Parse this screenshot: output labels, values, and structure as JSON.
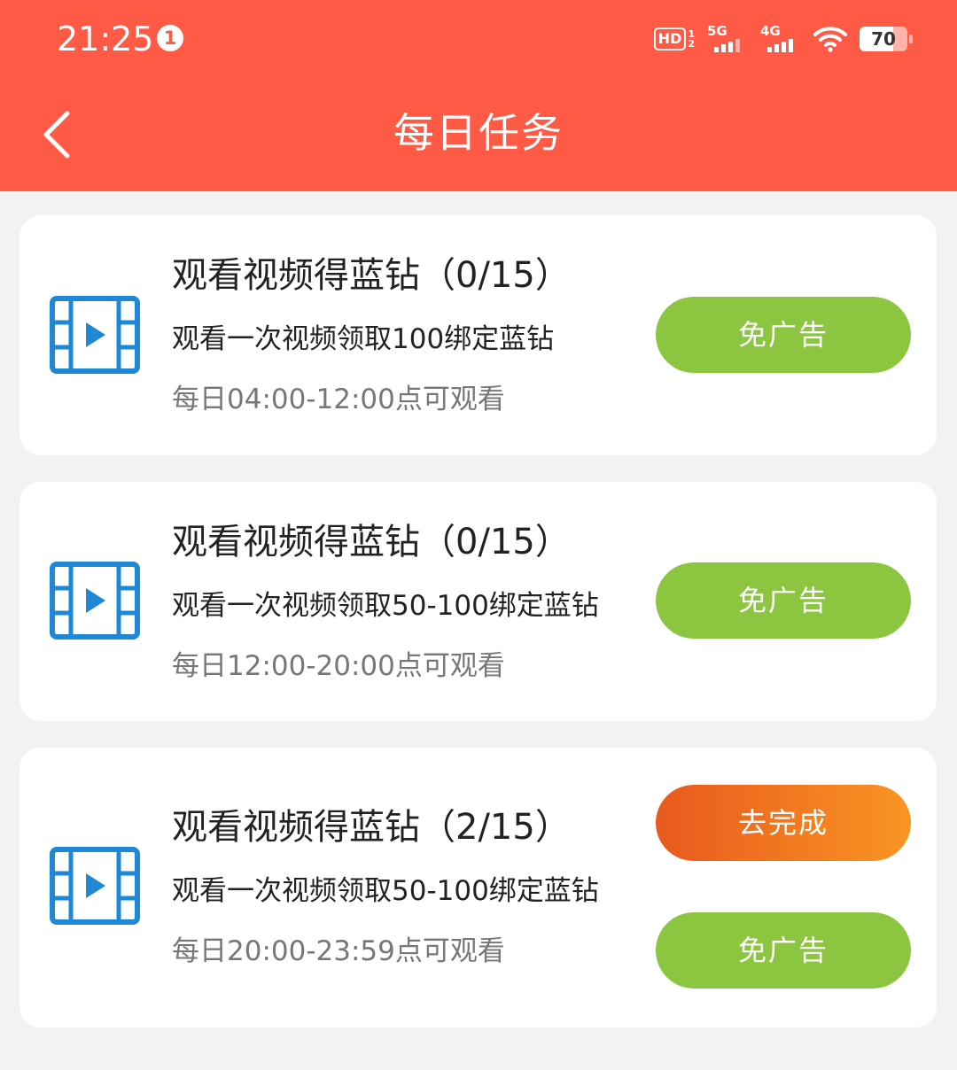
{
  "status_bar": {
    "time": "21:25",
    "notification_count": "1",
    "hd_label": "HD",
    "hd_sub_1": "1",
    "hd_sub_2": "2",
    "net_5g": "5G",
    "net_4g": "4G",
    "battery_percent": "70"
  },
  "header": {
    "title": "每日任务"
  },
  "tasks": [
    {
      "title": "观看视频得蓝钻（0/15）",
      "description": "观看一次视频领取100绑定蓝钻",
      "time_window": "每日04:00-12:00点可观看",
      "buttons": [
        "免广告"
      ]
    },
    {
      "title": "观看视频得蓝钻（0/15）",
      "description": "观看一次视频领取50-100绑定蓝钻",
      "time_window": "每日12:00-20:00点可观看",
      "buttons": [
        "免广告"
      ]
    },
    {
      "title": "观看视频得蓝钻（2/15）",
      "description": "观看一次视频领取50-100绑定蓝钻",
      "time_window": "每日20:00-23:59点可观看",
      "buttons": [
        "去完成",
        "免广告"
      ]
    }
  ],
  "colors": {
    "header_bg": "#ff5a46",
    "icon_blue": "#1e88d6",
    "button_green": "#8cc640",
    "button_orange_start": "#e8591e",
    "button_orange_end": "#fa9523"
  },
  "icons": {
    "back": "chevron-left-icon",
    "video": "video-film-icon"
  }
}
